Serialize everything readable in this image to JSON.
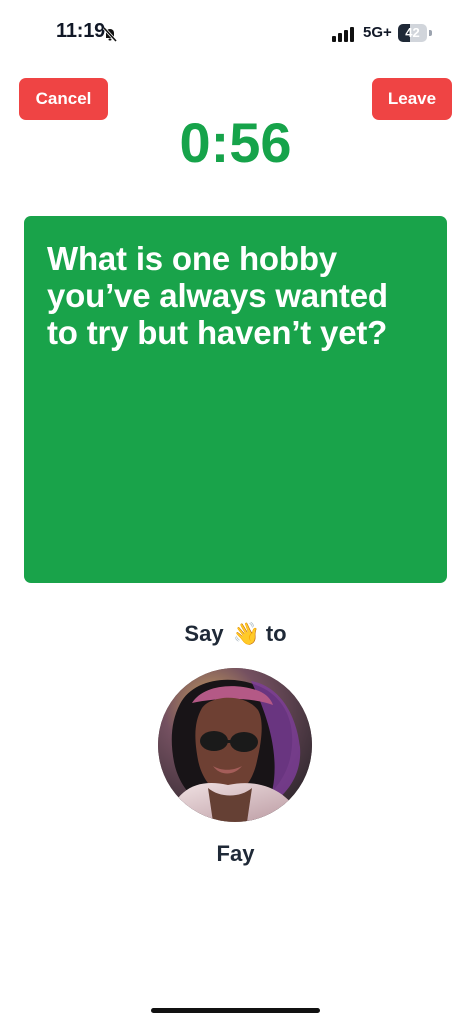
{
  "status_bar": {
    "time": "11:19",
    "network": "5G+",
    "battery": 42,
    "icons": [
      "bell-slash-icon",
      "signal-icon",
      "battery-icon"
    ]
  },
  "header": {
    "cancel_label": "Cancel",
    "leave_label": "Leave",
    "timer": "0:56"
  },
  "question": {
    "text": "What is one hobby you’ve always wanted to try but haven’t yet?"
  },
  "greeting": {
    "prefix": "Say",
    "emoji": "👋",
    "suffix": "to"
  },
  "contact": {
    "name": "Fay"
  },
  "colors": {
    "timer_green": "#16a34a",
    "card_green": "#19a34a",
    "button_red": "#ef4444"
  }
}
